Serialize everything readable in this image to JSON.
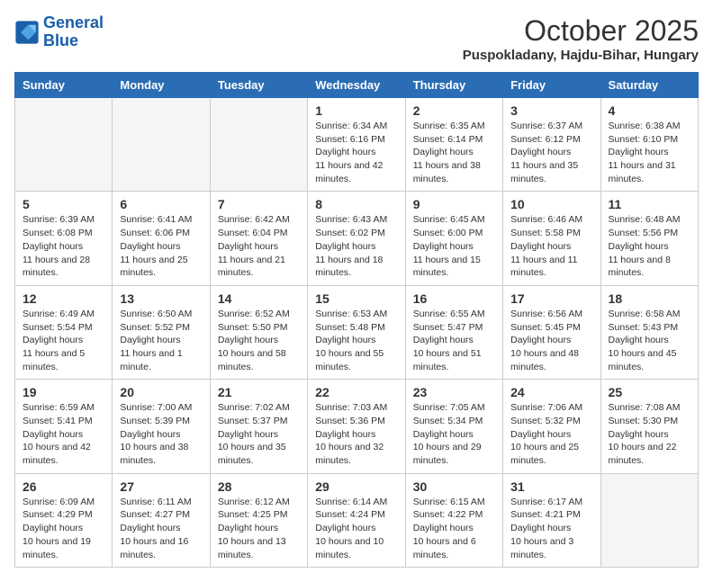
{
  "header": {
    "logo_line1": "General",
    "logo_line2": "Blue",
    "month": "October 2025",
    "location": "Puspokladany, Hajdu-Bihar, Hungary"
  },
  "weekdays": [
    "Sunday",
    "Monday",
    "Tuesday",
    "Wednesday",
    "Thursday",
    "Friday",
    "Saturday"
  ],
  "weeks": [
    [
      {
        "day": "",
        "empty": true
      },
      {
        "day": "",
        "empty": true
      },
      {
        "day": "",
        "empty": true
      },
      {
        "day": "1",
        "sunrise": "6:34 AM",
        "sunset": "6:16 PM",
        "daylight": "11 hours and 42 minutes."
      },
      {
        "day": "2",
        "sunrise": "6:35 AM",
        "sunset": "6:14 PM",
        "daylight": "11 hours and 38 minutes."
      },
      {
        "day": "3",
        "sunrise": "6:37 AM",
        "sunset": "6:12 PM",
        "daylight": "11 hours and 35 minutes."
      },
      {
        "day": "4",
        "sunrise": "6:38 AM",
        "sunset": "6:10 PM",
        "daylight": "11 hours and 31 minutes."
      }
    ],
    [
      {
        "day": "5",
        "sunrise": "6:39 AM",
        "sunset": "6:08 PM",
        "daylight": "11 hours and 28 minutes."
      },
      {
        "day": "6",
        "sunrise": "6:41 AM",
        "sunset": "6:06 PM",
        "daylight": "11 hours and 25 minutes."
      },
      {
        "day": "7",
        "sunrise": "6:42 AM",
        "sunset": "6:04 PM",
        "daylight": "11 hours and 21 minutes."
      },
      {
        "day": "8",
        "sunrise": "6:43 AM",
        "sunset": "6:02 PM",
        "daylight": "11 hours and 18 minutes."
      },
      {
        "day": "9",
        "sunrise": "6:45 AM",
        "sunset": "6:00 PM",
        "daylight": "11 hours and 15 minutes."
      },
      {
        "day": "10",
        "sunrise": "6:46 AM",
        "sunset": "5:58 PM",
        "daylight": "11 hours and 11 minutes."
      },
      {
        "day": "11",
        "sunrise": "6:48 AM",
        "sunset": "5:56 PM",
        "daylight": "11 hours and 8 minutes."
      }
    ],
    [
      {
        "day": "12",
        "sunrise": "6:49 AM",
        "sunset": "5:54 PM",
        "daylight": "11 hours and 5 minutes."
      },
      {
        "day": "13",
        "sunrise": "6:50 AM",
        "sunset": "5:52 PM",
        "daylight": "11 hours and 1 minute."
      },
      {
        "day": "14",
        "sunrise": "6:52 AM",
        "sunset": "5:50 PM",
        "daylight": "10 hours and 58 minutes."
      },
      {
        "day": "15",
        "sunrise": "6:53 AM",
        "sunset": "5:48 PM",
        "daylight": "10 hours and 55 minutes."
      },
      {
        "day": "16",
        "sunrise": "6:55 AM",
        "sunset": "5:47 PM",
        "daylight": "10 hours and 51 minutes."
      },
      {
        "day": "17",
        "sunrise": "6:56 AM",
        "sunset": "5:45 PM",
        "daylight": "10 hours and 48 minutes."
      },
      {
        "day": "18",
        "sunrise": "6:58 AM",
        "sunset": "5:43 PM",
        "daylight": "10 hours and 45 minutes."
      }
    ],
    [
      {
        "day": "19",
        "sunrise": "6:59 AM",
        "sunset": "5:41 PM",
        "daylight": "10 hours and 42 minutes."
      },
      {
        "day": "20",
        "sunrise": "7:00 AM",
        "sunset": "5:39 PM",
        "daylight": "10 hours and 38 minutes."
      },
      {
        "day": "21",
        "sunrise": "7:02 AM",
        "sunset": "5:37 PM",
        "daylight": "10 hours and 35 minutes."
      },
      {
        "day": "22",
        "sunrise": "7:03 AM",
        "sunset": "5:36 PM",
        "daylight": "10 hours and 32 minutes."
      },
      {
        "day": "23",
        "sunrise": "7:05 AM",
        "sunset": "5:34 PM",
        "daylight": "10 hours and 29 minutes."
      },
      {
        "day": "24",
        "sunrise": "7:06 AM",
        "sunset": "5:32 PM",
        "daylight": "10 hours and 25 minutes."
      },
      {
        "day": "25",
        "sunrise": "7:08 AM",
        "sunset": "5:30 PM",
        "daylight": "10 hours and 22 minutes."
      }
    ],
    [
      {
        "day": "26",
        "sunrise": "6:09 AM",
        "sunset": "4:29 PM",
        "daylight": "10 hours and 19 minutes."
      },
      {
        "day": "27",
        "sunrise": "6:11 AM",
        "sunset": "4:27 PM",
        "daylight": "10 hours and 16 minutes."
      },
      {
        "day": "28",
        "sunrise": "6:12 AM",
        "sunset": "4:25 PM",
        "daylight": "10 hours and 13 minutes."
      },
      {
        "day": "29",
        "sunrise": "6:14 AM",
        "sunset": "4:24 PM",
        "daylight": "10 hours and 10 minutes."
      },
      {
        "day": "30",
        "sunrise": "6:15 AM",
        "sunset": "4:22 PM",
        "daylight": "10 hours and 6 minutes."
      },
      {
        "day": "31",
        "sunrise": "6:17 AM",
        "sunset": "4:21 PM",
        "daylight": "10 hours and 3 minutes."
      },
      {
        "day": "",
        "empty": true
      }
    ]
  ]
}
